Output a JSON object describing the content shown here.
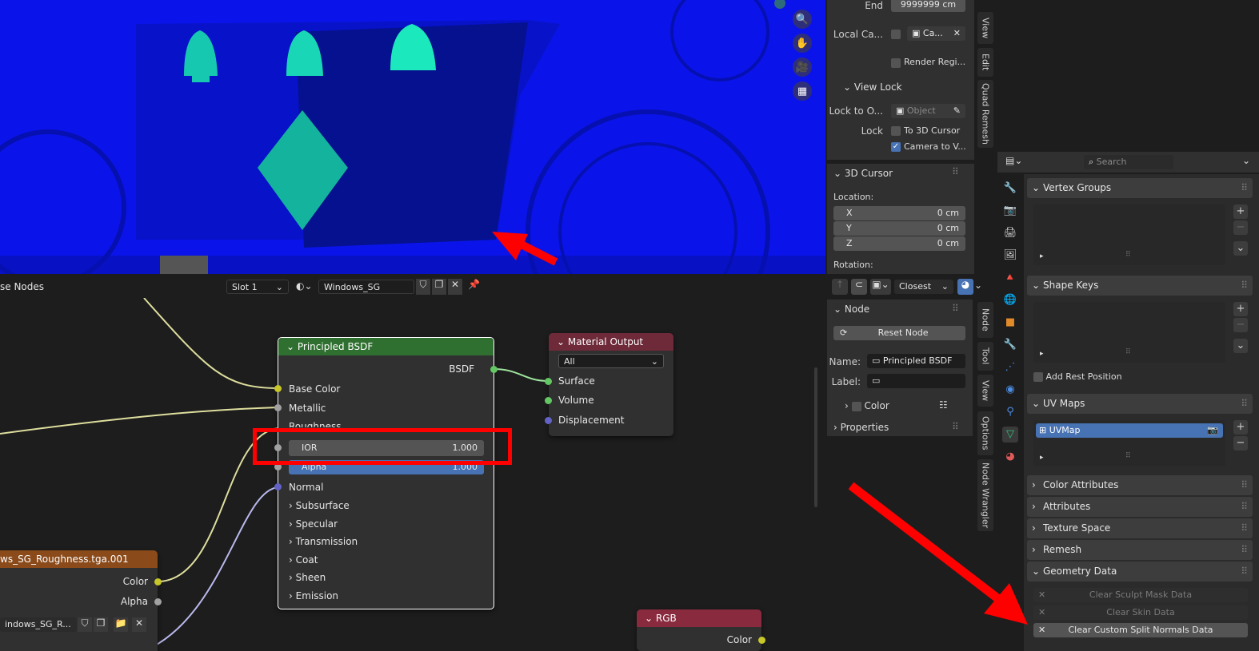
{
  "viewport": {
    "end_label": "End",
    "end_value": "9999999 cm",
    "local_camera_label": "Local Ca...",
    "local_camera_value": "Ca...",
    "render_region_label": "Render Regi...",
    "view_lock_header": "View Lock",
    "lock_to_object_label": "Lock to O...",
    "lock_to_object_placeholder": "Object",
    "lock_label": "Lock",
    "to_3d_cursor_label": "To 3D Cursor",
    "camera_to_view_label": "Camera to V...",
    "cursor_header": "3D Cursor",
    "location_label": "Location:",
    "x_label": "X",
    "x_value": "0 cm",
    "y_label": "Y",
    "y_value": "0 cm",
    "z_label": "Z",
    "z_value": "0 cm",
    "rotation_label": "Rotation:",
    "tabs": [
      "View",
      "Edit",
      "Quad Remesh"
    ]
  },
  "node_header": {
    "left_label": "se Nodes",
    "slot": "Slot 1",
    "material_name": "Windows_SG",
    "snap_mode": "Closest"
  },
  "node_sidebar": {
    "node_header": "Node",
    "reset_node": "Reset Node",
    "name_label": "Name:",
    "name_value": "Principled BSDF",
    "label_label": "Label:",
    "color_label": "Color",
    "properties_label": "Properties",
    "tabs": [
      "Node",
      "Tool",
      "View",
      "Options",
      "Node Wrangler"
    ]
  },
  "principled": {
    "title": "Principled BSDF",
    "output": "BSDF",
    "base_color": "Base Color",
    "metallic": "Metallic",
    "roughness": "Roughness",
    "ior_label": "IOR",
    "ior_value": "1.000",
    "alpha_label": "Alpha",
    "alpha_value": "1.000",
    "normal": "Normal",
    "panels": [
      "Subsurface",
      "Specular",
      "Transmission",
      "Coat",
      "Sheen",
      "Emission"
    ]
  },
  "material_output": {
    "title": "Material Output",
    "target": "All",
    "surface": "Surface",
    "volume": "Volume",
    "displacement": "Displacement"
  },
  "texture_node": {
    "title": "ws_SG_Roughness.tga.001",
    "color": "Color",
    "alpha": "Alpha",
    "image_name": "indows_SG_R..."
  },
  "rgb_node": {
    "title": "RGB",
    "color": "Color"
  },
  "properties": {
    "search_placeholder": "Search",
    "vertex_groups": "Vertex Groups",
    "shape_keys": "Shape Keys",
    "add_rest_position": "Add Rest Position",
    "uv_maps": "UV Maps",
    "uv_map_item": "UVMap",
    "color_attributes": "Color Attributes",
    "attributes": "Attributes",
    "texture_space": "Texture Space",
    "remesh": "Remesh",
    "geometry_data": "Geometry Data",
    "clear_sculpt": "Clear Sculpt Mask Data",
    "clear_skin": "Clear Skin Data",
    "clear_normals": "Clear Custom Split Normals Data"
  },
  "colors": {
    "viewport_bg": "#0a14ea",
    "principled_header": "#2f6f2f",
    "output_header": "#6e2a39",
    "texture_header": "#8a4a1a",
    "rgb_header": "#8a2a3e",
    "highlight": "#ff0000",
    "selected": "#4772b3"
  }
}
